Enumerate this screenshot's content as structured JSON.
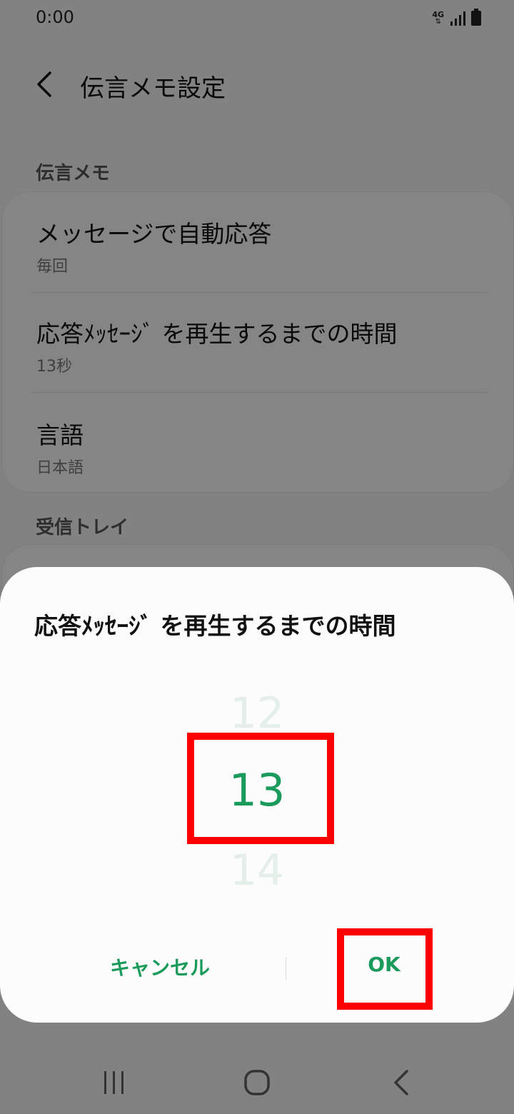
{
  "status_bar": {
    "time": "0:00",
    "network": "4G",
    "icons": [
      "network-4g-icon",
      "signal-icon",
      "battery-icon"
    ]
  },
  "app_bar": {
    "title": "伝言メモ設定",
    "back_icon": "chevron-left-icon"
  },
  "sections": [
    {
      "label": "伝言メモ",
      "items": [
        {
          "title": "メッセージで自動応答",
          "subtitle": "毎回"
        },
        {
          "title": "応答ﾒｯｾｰｼﾞ を再生するまでの時間",
          "subtitle": "13秒"
        },
        {
          "title": "言語",
          "subtitle": "日本語"
        }
      ]
    },
    {
      "label": "受信トレイ",
      "items": []
    }
  ],
  "dialog": {
    "title": "応答ﾒｯｾｰｼﾞ を再生するまでの時間",
    "picker": {
      "previous": "12",
      "selected": "13",
      "next": "14"
    },
    "cancel_label": "キャンセル",
    "ok_label": "OK"
  },
  "nav_bar": {
    "icons": [
      "recent-apps-icon",
      "home-icon",
      "back-icon"
    ]
  },
  "colors": {
    "accent": "#1a9a5b",
    "highlight": "#ff0000",
    "scrim": "rgba(0,0,0,0.47)"
  }
}
